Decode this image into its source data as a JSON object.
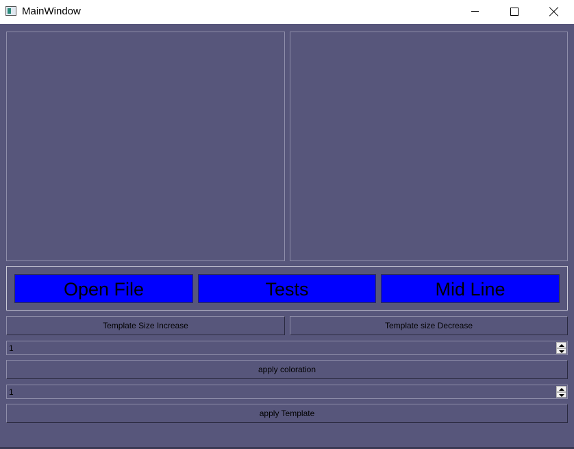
{
  "window": {
    "title": "MainWindow",
    "icon": "app-window-icon"
  },
  "buttons": {
    "open_file": "Open File",
    "tests": "Tests",
    "mid_line": "Mid Line",
    "template_size_increase": "Template Size Increase",
    "template_size_decrease": "Template size Decrease",
    "apply_coloration": "apply coloration",
    "apply_template": "apply Template"
  },
  "spinboxes": {
    "coloration_value": "1",
    "template_value": "1"
  },
  "colors": {
    "background": "#57567b",
    "primary_button": "#0000ff"
  }
}
